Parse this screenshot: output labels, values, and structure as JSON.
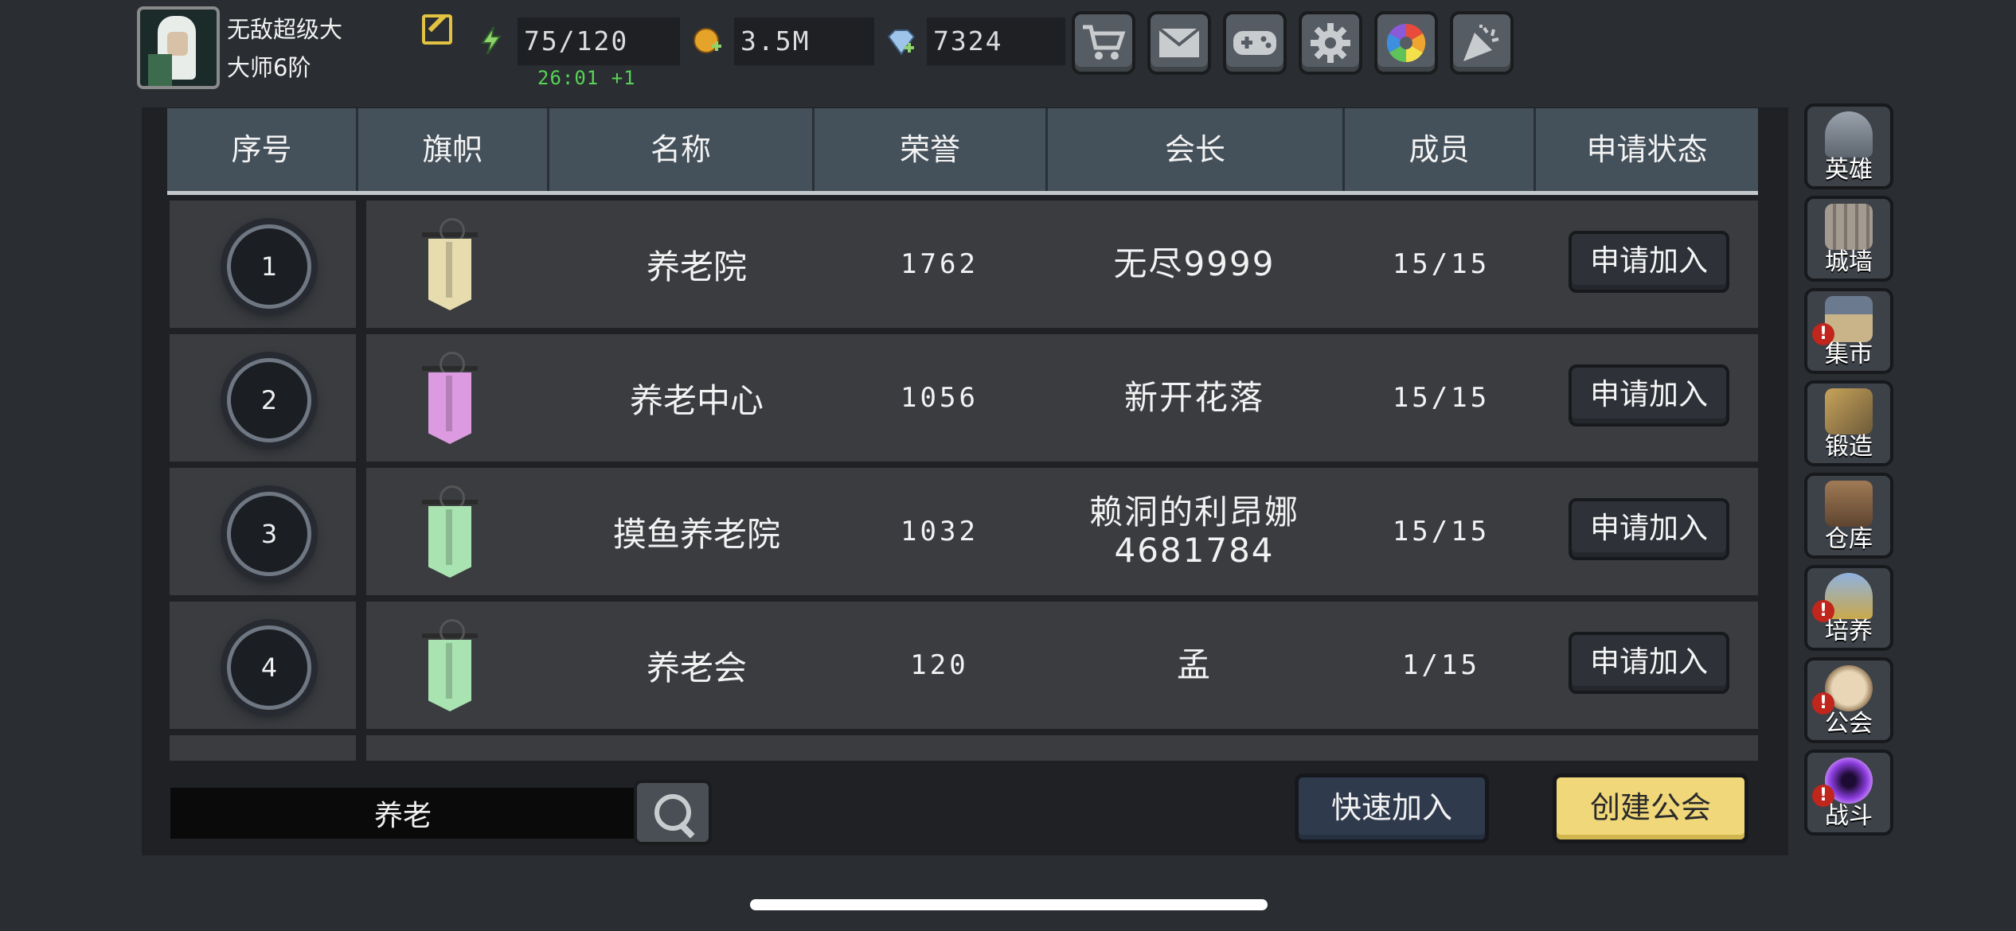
{
  "player": {
    "name": "无敌超级大",
    "rank": "大师6阶"
  },
  "resources": {
    "energy": "75/120",
    "energy_timer": "26:01 +1",
    "gold": "3.5M",
    "gems": "7324"
  },
  "toolbar": {
    "icons": [
      "shop-cart-icon",
      "mail-icon",
      "gamepad-icon",
      "settings-gear-icon",
      "color-wheel-icon",
      "celebration-icon"
    ]
  },
  "table": {
    "headers": [
      "序号",
      "旗帜",
      "名称",
      "荣誉",
      "会长",
      "成员",
      "申请状态"
    ],
    "rows": [
      {
        "index": "1",
        "name": "养老院",
        "honor": "1762",
        "leader": "无尽9999",
        "leader2": "",
        "members": "15/15",
        "action": "申请加入",
        "banner_color": "#e6dcae"
      },
      {
        "index": "2",
        "name": "养老中心",
        "honor": "1056",
        "leader": "新开花落",
        "leader2": "",
        "members": "15/15",
        "action": "申请加入",
        "banner_color": "#dc9be0"
      },
      {
        "index": "3",
        "name": "摸鱼养老院",
        "honor": "1032",
        "leader": "赖洞的利昂娜",
        "leader2": "4681784",
        "members": "15/15",
        "action": "申请加入",
        "banner_color": "#a9e3b1"
      },
      {
        "index": "4",
        "name": "养老会",
        "honor": "120",
        "leader": "孟",
        "leader2": "",
        "members": "1/15",
        "action": "申请加入",
        "banner_color": "#a9e3b1"
      }
    ]
  },
  "search": {
    "value": "养老"
  },
  "actions": {
    "quick_join": "快速加入",
    "create_guild": "创建公会"
  },
  "sidebar": {
    "items": [
      {
        "label": "英雄",
        "alert": false
      },
      {
        "label": "城墙",
        "alert": false
      },
      {
        "label": "集市",
        "alert": true
      },
      {
        "label": "锻造",
        "alert": false
      },
      {
        "label": "仓库",
        "alert": false
      },
      {
        "label": "培养",
        "alert": true
      },
      {
        "label": "公会",
        "alert": true
      },
      {
        "label": "战斗",
        "alert": true
      }
    ],
    "alert_mark": "!"
  },
  "colors": {
    "accent_yellow": "#f0d77a",
    "timer_green": "#57d357",
    "header_bg": "#44505a",
    "alert_red": "#c0261b"
  }
}
